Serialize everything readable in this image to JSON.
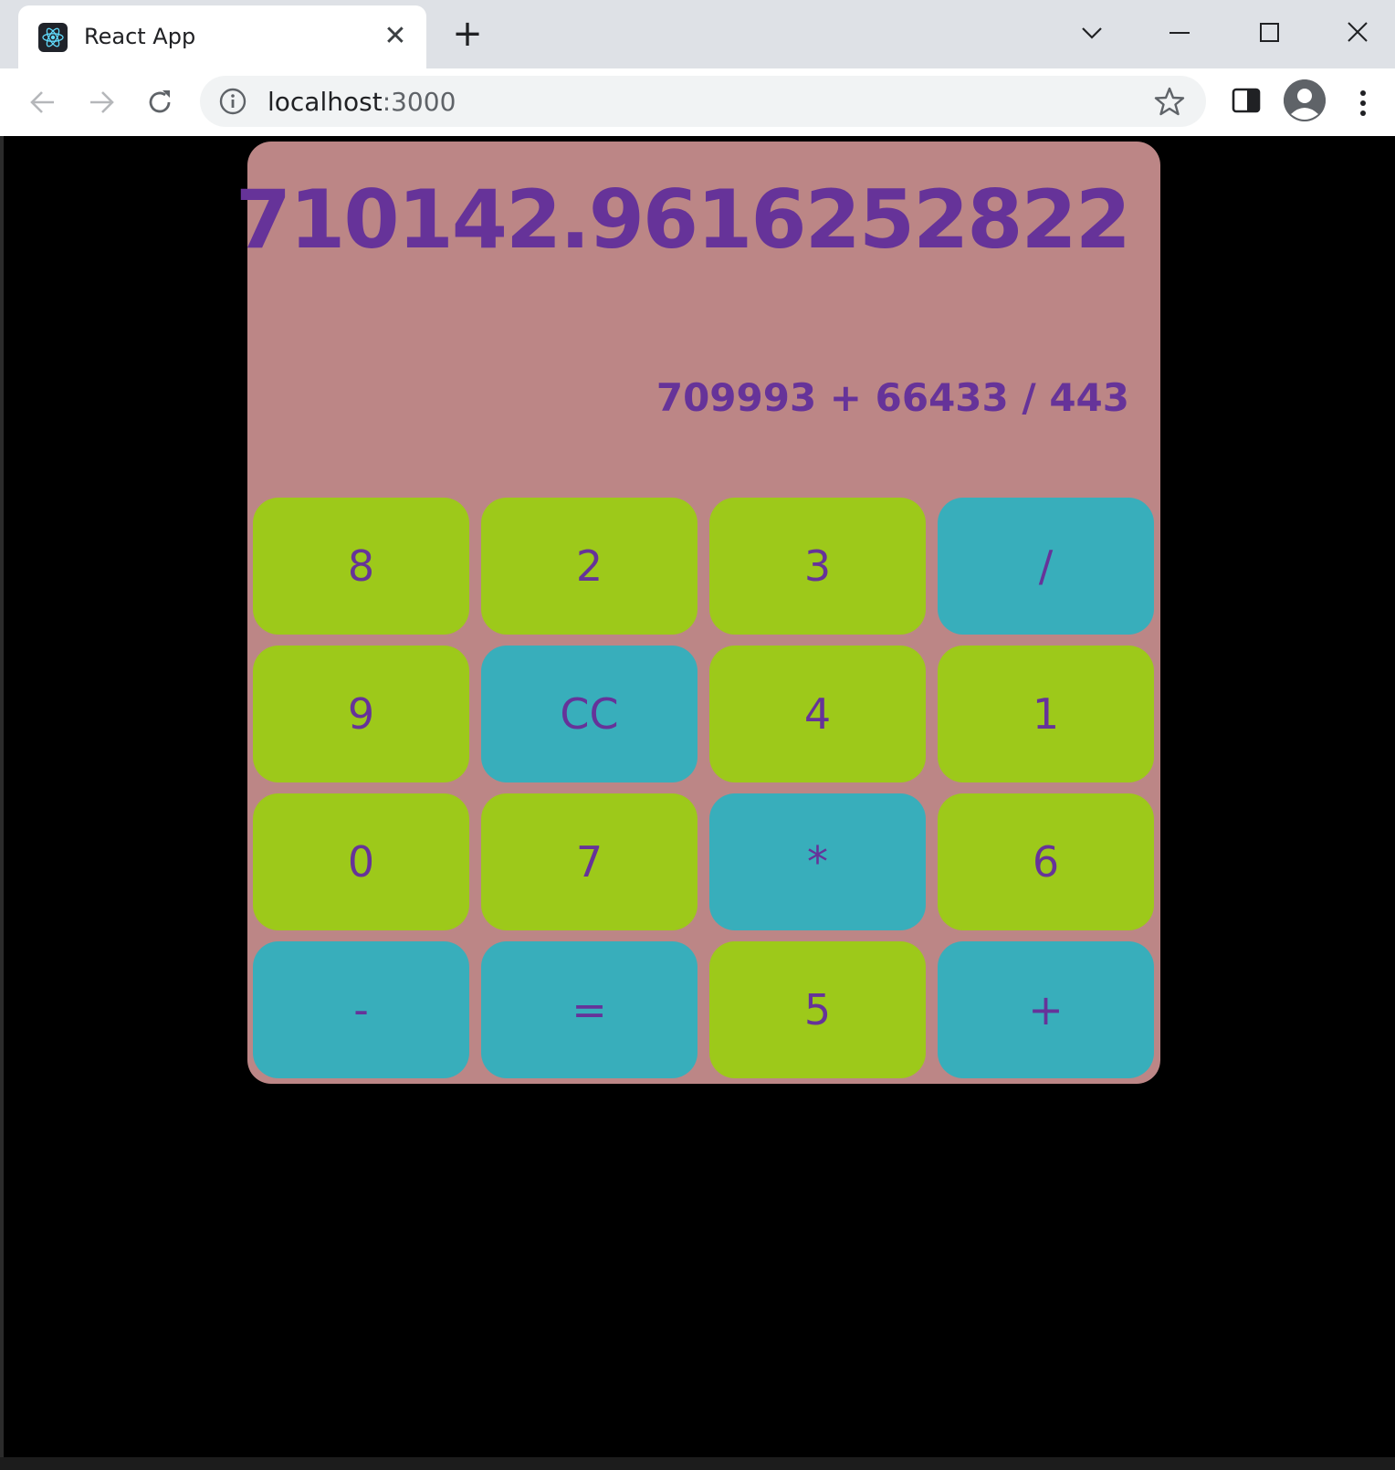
{
  "browser": {
    "tab_title": "React App",
    "tab_close_glyph": "✕",
    "new_tab_glyph": "+",
    "url_host": "localhost",
    "url_port": ":3000",
    "icons": [
      "react-logo-icon",
      "close-icon",
      "plus-icon",
      "chevron-down-icon",
      "minimize-icon",
      "maximize-icon",
      "close-window-icon",
      "back-arrow-icon",
      "forward-arrow-icon",
      "reload-icon",
      "info-icon",
      "star-icon",
      "side-panel-icon",
      "profile-icon",
      "kebab-menu-icon"
    ]
  },
  "calculator": {
    "result": "710142.9616252822",
    "expression": "709993 + 66433 / 443",
    "keys": [
      {
        "label": "8",
        "kind": "digit"
      },
      {
        "label": "2",
        "kind": "digit"
      },
      {
        "label": "3",
        "kind": "digit"
      },
      {
        "label": "/",
        "kind": "op"
      },
      {
        "label": "9",
        "kind": "digit"
      },
      {
        "label": "CC",
        "kind": "op"
      },
      {
        "label": "4",
        "kind": "digit"
      },
      {
        "label": "1",
        "kind": "digit"
      },
      {
        "label": "0",
        "kind": "digit"
      },
      {
        "label": "7",
        "kind": "digit"
      },
      {
        "label": "*",
        "kind": "op"
      },
      {
        "label": "6",
        "kind": "digit"
      },
      {
        "label": "-",
        "kind": "op"
      },
      {
        "label": "=",
        "kind": "op"
      },
      {
        "label": "5",
        "kind": "digit"
      },
      {
        "label": "+",
        "kind": "op"
      }
    ]
  },
  "colors": {
    "panel": "#bc8686",
    "digit_key": "#9dc91a",
    "operator_key": "#38aebb",
    "text": "#663399",
    "page_background": "#000000"
  }
}
